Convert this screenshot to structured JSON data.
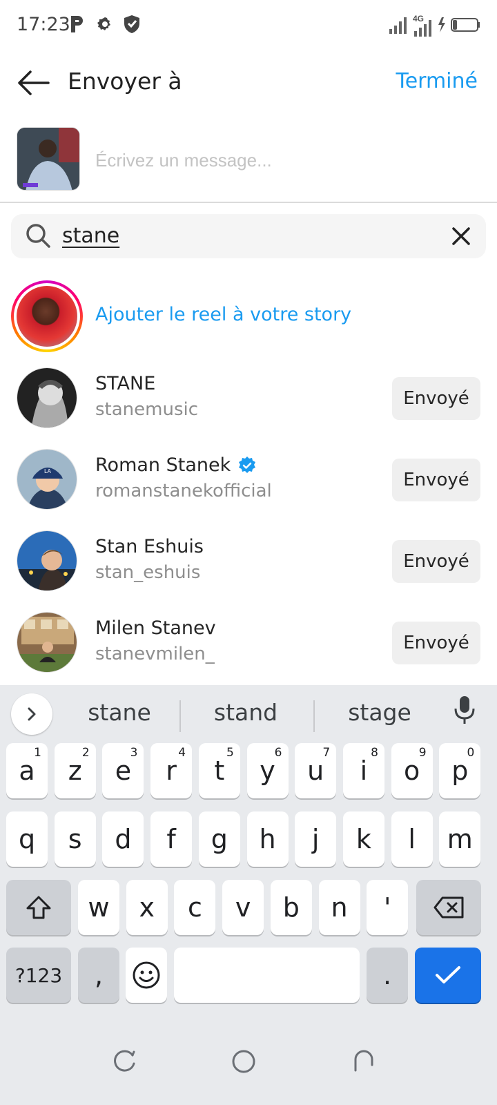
{
  "status_bar": {
    "time": "17:23",
    "network_label": "4G",
    "icons": [
      "parking-icon",
      "settings-icon",
      "shield-icon",
      "signal-icon",
      "signal-4g-icon",
      "battery-charging-icon"
    ]
  },
  "header": {
    "title": "Envoyer à",
    "done_label": "Terminé",
    "accent_color": "#1a9bf0"
  },
  "compose": {
    "placeholder": "Écrivez un message..."
  },
  "search": {
    "query": "stane"
  },
  "story_action": {
    "label": "Ajouter le reel à votre story"
  },
  "results": [
    {
      "name": "STANE",
      "username": "stanemusic",
      "verified": false,
      "button": "Envoyé"
    },
    {
      "name": "Roman Stanek",
      "username": "romanstanekofficial",
      "verified": true,
      "button": "Envoyé"
    },
    {
      "name": "Stan Eshuis",
      "username": "stan_eshuis",
      "verified": false,
      "button": "Envoyé"
    },
    {
      "name": "Milen Stanev",
      "username": "stanevmilen_",
      "verified": false,
      "button": "Envoyé"
    }
  ],
  "keyboard": {
    "suggestions": [
      "stane",
      "stand",
      "stage"
    ],
    "row1": [
      {
        "k": "a",
        "h": "1"
      },
      {
        "k": "z",
        "h": "2"
      },
      {
        "k": "e",
        "h": "3"
      },
      {
        "k": "r",
        "h": "4"
      },
      {
        "k": "t",
        "h": "5"
      },
      {
        "k": "y",
        "h": "6"
      },
      {
        "k": "u",
        "h": "7"
      },
      {
        "k": "i",
        "h": "8"
      },
      {
        "k": "o",
        "h": "9"
      },
      {
        "k": "p",
        "h": "0"
      }
    ],
    "row2": [
      "q",
      "s",
      "d",
      "f",
      "g",
      "h",
      "j",
      "k",
      "l",
      "m"
    ],
    "row3": [
      "w",
      "x",
      "c",
      "v",
      "b",
      "n",
      "'"
    ],
    "symbols_label": "?123",
    "comma": ",",
    "period": "."
  }
}
